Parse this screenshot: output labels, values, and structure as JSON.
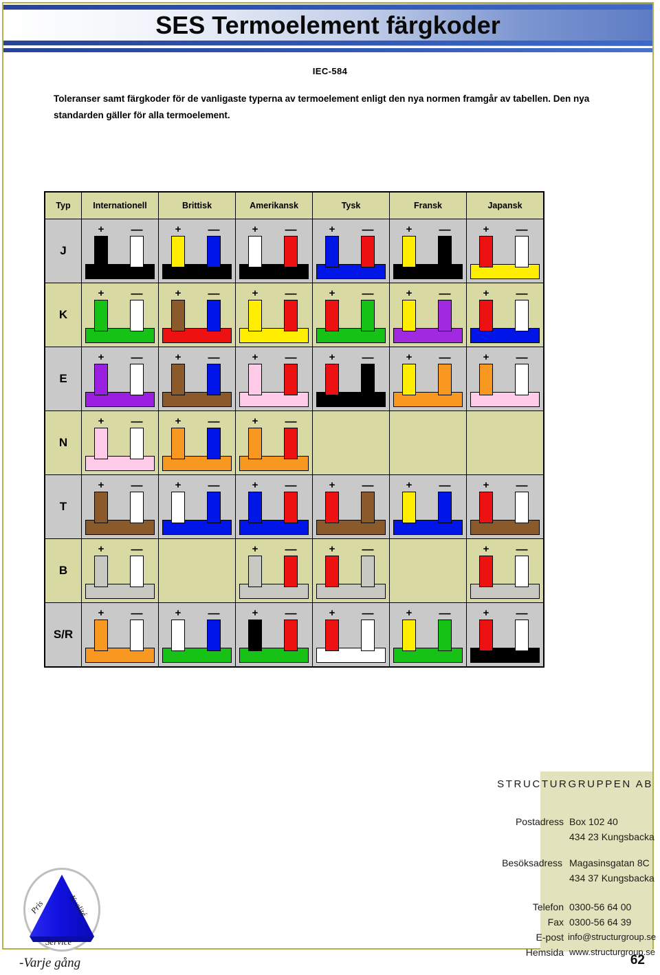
{
  "page": {
    "title": "SES Termoelement färgkoder",
    "standard": "IEC-584",
    "intro": "Toleranser samt färgkoder för de vanligaste typerna av termoelement enligt den nya normen framgår av tabellen. Den nya standarden gäller för alla termoelement.",
    "page_number": "62"
  },
  "colors": {
    "banner_blue": "#3156b4",
    "page_border": "#b3b34d",
    "header_fill": "#d9d9a3",
    "row_gray": "#c9c9c9",
    "row_khaki": "#d9d9a3",
    "footer_band": "#e2e2bc",
    "logo_blue": "#1a1aee"
  },
  "table": {
    "plus_sign": "+",
    "minus_sign": "—",
    "columns": [
      "Typ",
      "Internationell",
      "Brittisk",
      "Amerikansk",
      "Tysk",
      "Fransk",
      "Japansk"
    ],
    "rows": [
      {
        "type": "J",
        "band": "gray",
        "cells": [
          {
            "country": "Internationell",
            "present": true,
            "plus": "#000000",
            "minus": "#ffffff",
            "base": "#000000"
          },
          {
            "country": "Brittisk",
            "present": true,
            "plus": "#ffee00",
            "minus": "#0016e8",
            "base": "#000000"
          },
          {
            "country": "Amerikansk",
            "present": true,
            "plus": "#ffffff",
            "minus": "#ee1111",
            "base": "#000000"
          },
          {
            "country": "Tysk",
            "present": true,
            "plus": "#0016e8",
            "minus": "#ee1111",
            "base": "#0016e8"
          },
          {
            "country": "Fransk",
            "present": true,
            "plus": "#ffee00",
            "minus": "#000000",
            "base": "#000000"
          },
          {
            "country": "Japansk",
            "present": true,
            "plus": "#ee1111",
            "minus": "#ffffff",
            "base": "#ffee00"
          }
        ]
      },
      {
        "type": "K",
        "band": "khaki",
        "cells": [
          {
            "country": "Internationell",
            "present": true,
            "plus": "#16c216",
            "minus": "#ffffff",
            "base": "#16c216"
          },
          {
            "country": "Brittisk",
            "present": true,
            "plus": "#8a5a2b",
            "minus": "#0016e8",
            "base": "#ee1111"
          },
          {
            "country": "Amerikansk",
            "present": true,
            "plus": "#ffee00",
            "minus": "#ee1111",
            "base": "#ffee00"
          },
          {
            "country": "Tysk",
            "present": true,
            "plus": "#ee1111",
            "minus": "#16c216",
            "base": "#16c216"
          },
          {
            "country": "Fransk",
            "present": true,
            "plus": "#ffee00",
            "minus": "#a12ae0",
            "base": "#a12ae0"
          },
          {
            "country": "Japansk",
            "present": true,
            "plus": "#ee1111",
            "minus": "#ffffff",
            "base": "#0016e8"
          }
        ]
      },
      {
        "type": "E",
        "band": "gray",
        "cells": [
          {
            "country": "Internationell",
            "present": true,
            "plus": "#9b1fe0",
            "minus": "#ffffff",
            "base": "#9b1fe0"
          },
          {
            "country": "Brittisk",
            "present": true,
            "plus": "#8a5a2b",
            "minus": "#0016e8",
            "base": "#8a5a2b"
          },
          {
            "country": "Amerikansk",
            "present": true,
            "plus": "#ffcbe8",
            "minus": "#ee1111",
            "base": "#ffcbe8"
          },
          {
            "country": "Tysk",
            "present": true,
            "plus": "#ee1111",
            "minus": "#000000",
            "base": "#000000"
          },
          {
            "country": "Fransk",
            "present": true,
            "plus": "#ffee00",
            "minus": "#f89820",
            "base": "#f89820"
          },
          {
            "country": "Japansk",
            "present": true,
            "plus": "#f89820",
            "minus": "#ffffff",
            "base": "#ffcbe8"
          }
        ]
      },
      {
        "type": "N",
        "band": "khaki",
        "cells": [
          {
            "country": "Internationell",
            "present": true,
            "plus": "#ffcbe8",
            "minus": "#ffffff",
            "base": "#ffcbe8"
          },
          {
            "country": "Brittisk",
            "present": true,
            "plus": "#f89820",
            "minus": "#0016e8",
            "base": "#f89820"
          },
          {
            "country": "Amerikansk",
            "present": true,
            "plus": "#f89820",
            "minus": "#ee1111",
            "base": "#f89820"
          },
          {
            "country": "Tysk",
            "present": false,
            "plus": "",
            "minus": "",
            "base": ""
          },
          {
            "country": "Fransk",
            "present": false,
            "plus": "",
            "minus": "",
            "base": ""
          },
          {
            "country": "Japansk",
            "present": false,
            "plus": "",
            "minus": "",
            "base": ""
          }
        ]
      },
      {
        "type": "T",
        "band": "gray",
        "cells": [
          {
            "country": "Internationell",
            "present": true,
            "plus": "#8a5a2b",
            "minus": "#ffffff",
            "base": "#8a5a2b"
          },
          {
            "country": "Brittisk",
            "present": true,
            "plus": "#ffffff",
            "minus": "#0016e8",
            "base": "#0016e8"
          },
          {
            "country": "Amerikansk",
            "present": true,
            "plus": "#0016e8",
            "minus": "#ee1111",
            "base": "#0016e8"
          },
          {
            "country": "Tysk",
            "present": true,
            "plus": "#ee1111",
            "minus": "#8a5a2b",
            "base": "#8a5a2b"
          },
          {
            "country": "Fransk",
            "present": true,
            "plus": "#ffee00",
            "minus": "#0016e8",
            "base": "#0016e8"
          },
          {
            "country": "Japansk",
            "present": true,
            "plus": "#ee1111",
            "minus": "#ffffff",
            "base": "#8a5a2b"
          }
        ]
      },
      {
        "type": "B",
        "band": "khaki",
        "cells": [
          {
            "country": "Internationell",
            "present": true,
            "plus": "#c8c8c2",
            "minus": "#ffffff",
            "base": "#c8c8c2"
          },
          {
            "country": "Brittisk",
            "present": false,
            "plus": "",
            "minus": "",
            "base": ""
          },
          {
            "country": "Amerikansk",
            "present": true,
            "plus": "#c8c8c2",
            "minus": "#ee1111",
            "base": "#c8c8c2"
          },
          {
            "country": "Tysk",
            "present": true,
            "plus": "#ee1111",
            "minus": "#c8c8c2",
            "base": "#c8c8c2"
          },
          {
            "country": "Fransk",
            "present": false,
            "plus": "",
            "minus": "",
            "base": ""
          },
          {
            "country": "Japansk",
            "present": true,
            "plus": "#ee1111",
            "minus": "#ffffff",
            "base": "#c8c8c2"
          }
        ]
      },
      {
        "type": "S/R",
        "band": "gray",
        "cells": [
          {
            "country": "Internationell",
            "present": true,
            "plus": "#f89820",
            "minus": "#ffffff",
            "base": "#f89820"
          },
          {
            "country": "Brittisk",
            "present": true,
            "plus": "#ffffff",
            "minus": "#0016e8",
            "base": "#16c216"
          },
          {
            "country": "Amerikansk",
            "present": true,
            "plus": "#000000",
            "minus": "#ee1111",
            "base": "#16c216"
          },
          {
            "country": "Tysk",
            "present": true,
            "plus": "#ee1111",
            "minus": "#ffffff",
            "base": "#ffffff"
          },
          {
            "country": "Fransk",
            "present": true,
            "plus": "#ffee00",
            "minus": "#16c216",
            "base": "#16c216"
          },
          {
            "country": "Japansk",
            "present": true,
            "plus": "#ee1111",
            "minus": "#ffffff",
            "base": "#000000"
          }
        ]
      }
    ]
  },
  "footer": {
    "company": "STRUCTURGRUPPEN AB",
    "entries": [
      {
        "label": "Postadress",
        "line1": "Box 102 40",
        "line2": "434 23 Kungsbacka"
      },
      {
        "label": "Besöksadress",
        "line1": "Magasinsgatan 8C",
        "line2": "434 37 Kungsbacka"
      }
    ],
    "contacts": [
      {
        "label": "Telefon",
        "value": "0300-56 64 00"
      },
      {
        "label": "Fax",
        "value": "0300-56 64 39"
      },
      {
        "label": "E-post",
        "value": "info@structurgroup.se"
      },
      {
        "label": "Hemsida",
        "value": "www.structurgroup.se"
      }
    ],
    "logo": {
      "word_top_left": "Pris",
      "word_top_right": "Kvalité",
      "word_bottom": "Service",
      "tagline": "-Varje gång"
    }
  }
}
